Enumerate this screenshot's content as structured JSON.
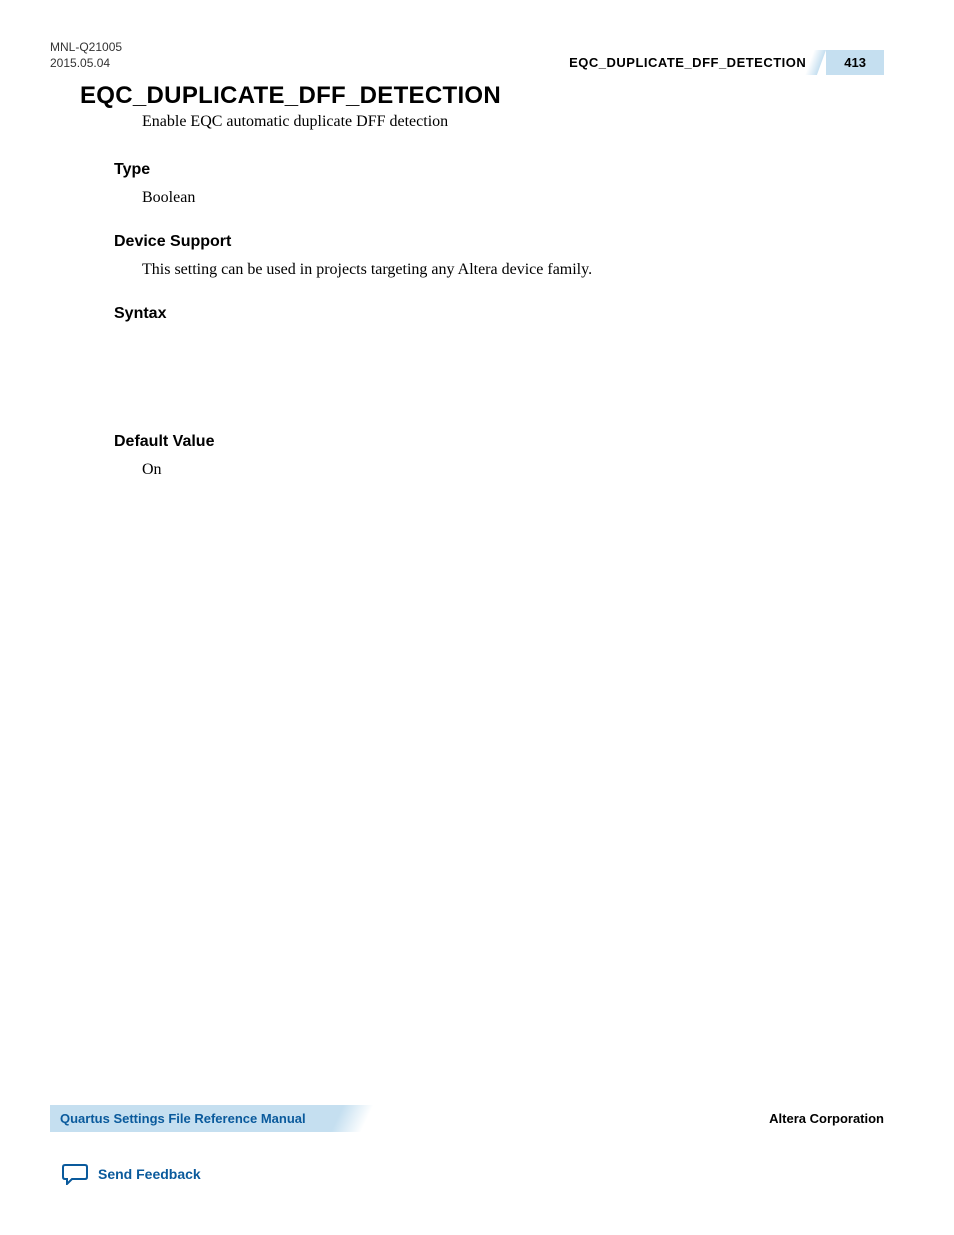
{
  "header": {
    "doc_id": "MNL-Q21005",
    "date": "2015.05.04",
    "running_title": "EQC_DUPLICATE_DFF_DETECTION",
    "page_number": "413"
  },
  "main": {
    "title": "EQC_DUPLICATE_DFF_DETECTION",
    "description": "Enable EQC automatic duplicate DFF detection",
    "sections": {
      "type": {
        "heading": "Type",
        "body": "Boolean"
      },
      "device_support": {
        "heading": "Device Support",
        "body": "This setting can be used in projects targeting any Altera device family."
      },
      "syntax": {
        "heading": "Syntax",
        "body": ""
      },
      "default_value": {
        "heading": "Default Value",
        "body": "On"
      }
    }
  },
  "footer": {
    "manual_title": "Quartus Settings File Reference Manual",
    "company": "Altera Corporation",
    "feedback_label": "Send Feedback"
  }
}
